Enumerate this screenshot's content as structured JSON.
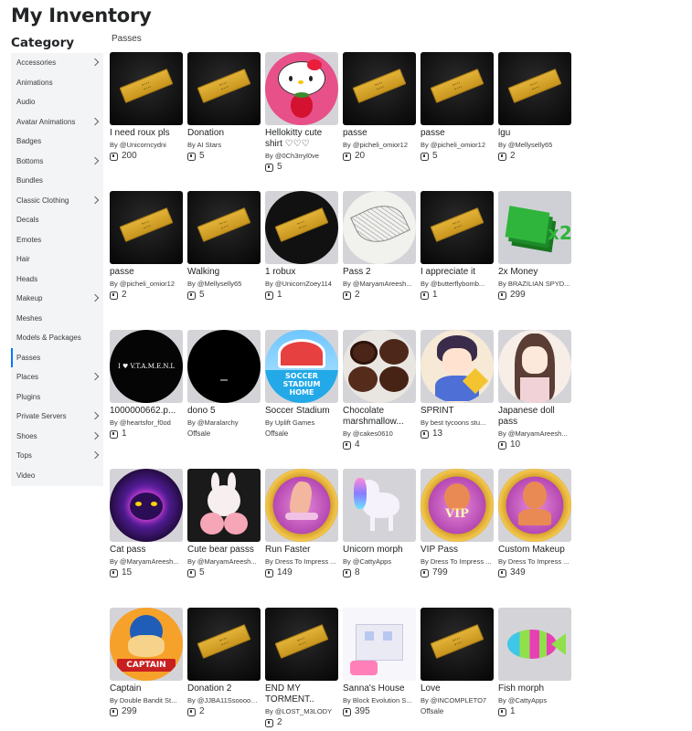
{
  "page": {
    "title": "My Inventory",
    "category_title": "Category",
    "section_label": "Passes"
  },
  "sidebar": {
    "items": [
      {
        "label": "Accessories",
        "chevron": true
      },
      {
        "label": "Animations",
        "chevron": false
      },
      {
        "label": "Audio",
        "chevron": false
      },
      {
        "label": "Avatar Animations",
        "chevron": true
      },
      {
        "label": "Badges",
        "chevron": false
      },
      {
        "label": "Bottoms",
        "chevron": true
      },
      {
        "label": "Bundles",
        "chevron": false
      },
      {
        "label": "Classic Clothing",
        "chevron": true
      },
      {
        "label": "Decals",
        "chevron": false
      },
      {
        "label": "Emotes",
        "chevron": false
      },
      {
        "label": "Hair",
        "chevron": false
      },
      {
        "label": "Heads",
        "chevron": false
      },
      {
        "label": "Makeup",
        "chevron": true
      },
      {
        "label": "Meshes",
        "chevron": false
      },
      {
        "label": "Models & Packages",
        "chevron": false
      },
      {
        "label": "Passes",
        "chevron": false,
        "active": true
      },
      {
        "label": "Places",
        "chevron": true
      },
      {
        "label": "Plugins",
        "chevron": false
      },
      {
        "label": "Private Servers",
        "chevron": true
      },
      {
        "label": "Shoes",
        "chevron": true
      },
      {
        "label": "Tops",
        "chevron": true
      },
      {
        "label": "Video",
        "chevron": false
      }
    ]
  },
  "items": [
    {
      "name": "I need roux pls",
      "creator": "@Unicorncydni",
      "price": "200",
      "thumb": "pass"
    },
    {
      "name": "Donation",
      "creator": "AI Stars",
      "price": "5",
      "thumb": "pass"
    },
    {
      "name": "Hellokitty cute shirt ♡♡♡",
      "creator": "@0Ch3rryl0ve",
      "price": "5",
      "thumb": "kitty"
    },
    {
      "name": "passe",
      "creator": "@picheli_omior12",
      "price": "20",
      "thumb": "pass"
    },
    {
      "name": "passe",
      "creator": "@picheli_omior12",
      "price": "5",
      "thumb": "pass"
    },
    {
      "name": "lgu",
      "creator": "@Mellyselly65",
      "price": "2",
      "thumb": "pass"
    },
    {
      "name": "passe",
      "creator": "@picheli_omior12",
      "price": "2",
      "thumb": "pass"
    },
    {
      "name": "Walking",
      "creator": "@Mellyselly65",
      "price": "5",
      "thumb": "pass"
    },
    {
      "name": "1 robux",
      "creator": "@UnicornZoey114",
      "price": "1",
      "thumb": "pass-circle"
    },
    {
      "name": "Pass 2",
      "creator": "@MaryamAreesh...",
      "price": "2",
      "thumb": "leaf"
    },
    {
      "name": "I appreciate it",
      "creator": "@butterflybomb...",
      "price": "1",
      "thumb": "pass"
    },
    {
      "name": "2x Money",
      "creator": "BRAZILIAN SPYD...",
      "price": "299",
      "thumb": "money"
    },
    {
      "name": "1000000662.p...",
      "creator": "@heartsfor_f0od",
      "price": "1",
      "thumb": "heart-text",
      "thumb_text": "I ♥ V.T.A.M.E.N.L"
    },
    {
      "name": "dono 5",
      "creator": "@Maralarchy",
      "price": "",
      "offsale": "Offsale",
      "thumb": "black-circle"
    },
    {
      "name": "Soccer Stadium",
      "creator": "Uplift Games",
      "price": "",
      "offsale": "Offsale",
      "thumb": "soccer",
      "thumb_text": "SOCCER STADIUM HOME"
    },
    {
      "name": "Chocolate marshmallow...",
      "creator": "@cakes0610",
      "price": "4",
      "thumb": "cookies"
    },
    {
      "name": "SPRINT",
      "creator": "best tycoons stu...",
      "price": "13",
      "thumb": "anime-boy"
    },
    {
      "name": "Japanese doll pass",
      "creator": "@MaryamAreesh...",
      "price": "10",
      "thumb": "anime-girl"
    },
    {
      "name": "Cat pass",
      "creator": "@MaryamAreesh...",
      "price": "15",
      "thumb": "neon-cat"
    },
    {
      "name": "Cute bear passs",
      "creator": "@MaryamAreesh...",
      "price": "5",
      "thumb": "bunny"
    },
    {
      "name": "Run Faster",
      "creator": "Dress To Impress ...",
      "price": "149",
      "thumb": "dti-heels"
    },
    {
      "name": "Unicorn morph",
      "creator": "@CattyApps",
      "price": "8",
      "thumb": "unicorn"
    },
    {
      "name": "VIP Pass",
      "creator": "Dress To Impress ...",
      "price": "799",
      "thumb": "dti-vip",
      "thumb_text": "VIP"
    },
    {
      "name": "Custom Makeup",
      "creator": "Dress To Impress ...",
      "price": "349",
      "thumb": "dti-makeup"
    },
    {
      "name": "Captain",
      "creator": "Double Bandit St...",
      "price": "299",
      "thumb": "captain",
      "thumb_text": "CAPTAIN"
    },
    {
      "name": "Donation 2",
      "creator": "@JJBA11Ssooooo_...",
      "price": "2",
      "thumb": "pass"
    },
    {
      "name": "END MY TORMENT..",
      "creator": "@LOST_M3LODY",
      "price": "2",
      "thumb": "pass"
    },
    {
      "name": "Sanna's House",
      "creator": "Block Evolution S...",
      "price": "395",
      "thumb": "house"
    },
    {
      "name": "Love",
      "creator": "@INCOMPLETO7",
      "price": "",
      "offsale": "Offsale",
      "thumb": "pass"
    },
    {
      "name": "Fish morph",
      "creator": "@CattyApps",
      "price": "1",
      "thumb": "fish"
    }
  ],
  "labels": {
    "by": "By"
  },
  "colors": {
    "sidebar_bg": "#f2f4f5",
    "active_accent": "#0077ff",
    "thumb_bg": "#d4d4d8",
    "text": "#393b3d"
  }
}
